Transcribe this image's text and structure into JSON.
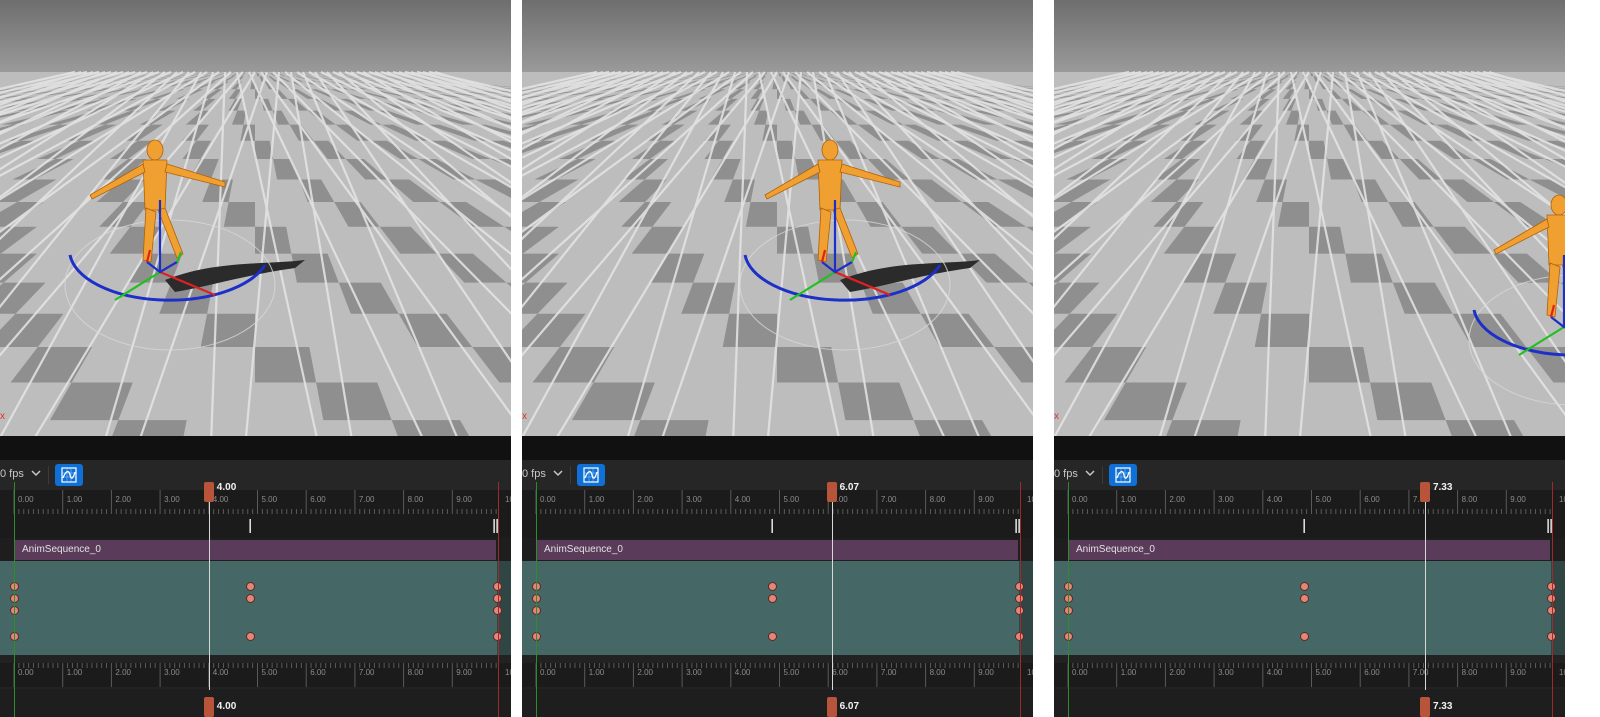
{
  "axis_label": "x",
  "fps_label": "0 fps",
  "track_name": "AnimSequence_0",
  "ruler_ticks": [
    "0.00",
    "1.00",
    "2.00",
    "3.00",
    "4.00",
    "5.00",
    "6.00",
    "7.00",
    "8.00",
    "9.00",
    "10."
  ],
  "panels": [
    {
      "time": "4.00",
      "playhead_seconds": 4.0
    },
    {
      "time": "6.07",
      "playhead_seconds": 6.07
    },
    {
      "time": "7.33",
      "playhead_seconds": 7.33
    }
  ],
  "colors": {
    "accent_blue": "#0f70d7",
    "playhead_marker": "#b8543a",
    "anim_track": "#5a3b5a",
    "curve_area": "#456866",
    "keyframe": "#e58578",
    "start_bound": "#2e8b2e",
    "end_bound": "#a02a2a",
    "character": "#f0a030"
  },
  "icons": {
    "fps_dropdown": "chevron-down-icon",
    "graph_button": "curve-editor-icon"
  }
}
